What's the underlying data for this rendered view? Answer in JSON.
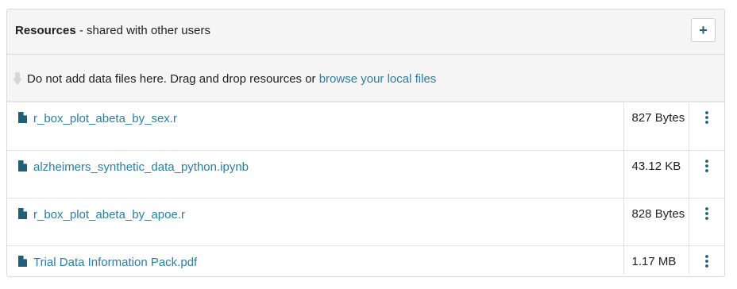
{
  "panel": {
    "title_strong": "Resources",
    "title_rest": " - shared with other users",
    "add_button_label": "+"
  },
  "dropzone": {
    "icon": "arrow-down-icon",
    "text": "Do not add data files here. Drag and drop resources or ",
    "link_text": "browse your local files"
  },
  "files": [
    {
      "name": "r_box_plot_abeta_by_sex.r",
      "size": "827 Bytes",
      "icon": "file-icon"
    },
    {
      "name": "alzheimers_synthetic_data_python.ipynb",
      "size": "43.12 KB",
      "icon": "file-icon"
    },
    {
      "name": "r_box_plot_abeta_by_apoe.r",
      "size": "828 Bytes",
      "icon": "file-icon"
    },
    {
      "name": "Trial Data Information Pack.pdf",
      "size": "1.17 MB",
      "icon": "file-icon"
    }
  ],
  "colors": {
    "link": "#2a7f9e",
    "button_text": "#1f5f78",
    "header_bg": "#f5f5f5"
  }
}
